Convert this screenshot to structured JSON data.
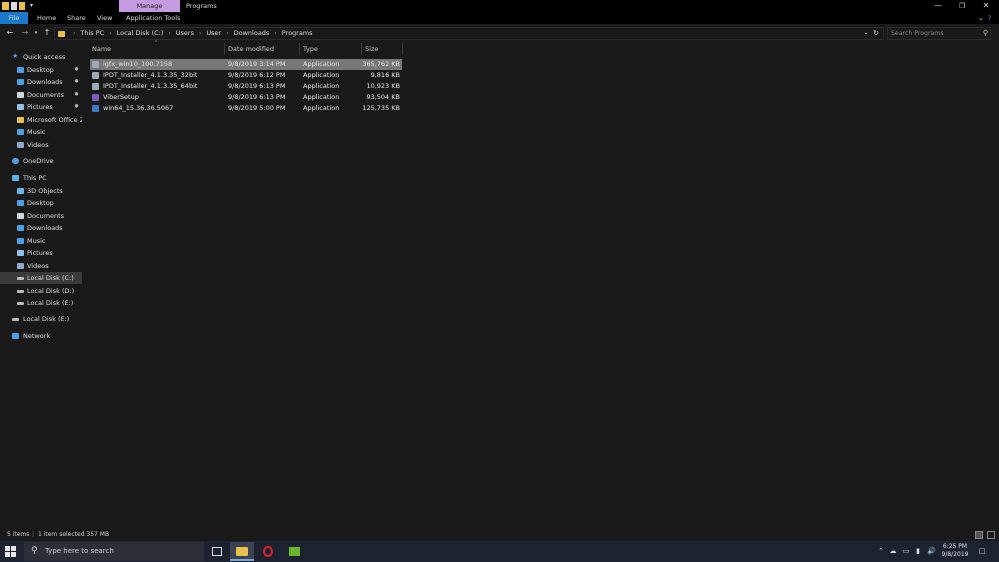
{
  "titlebar": {
    "contextual_tab": "Manage",
    "window_title": "Programs",
    "minimize": "—",
    "maximize": "❐",
    "close": "✕"
  },
  "ribbon": {
    "tabs": [
      "File",
      "Home",
      "Share",
      "View",
      "Application Tools"
    ]
  },
  "address": {
    "crumbs": [
      "This PC",
      "Local Disk (C:)",
      "Users",
      "User",
      "Downloads",
      "Programs"
    ],
    "search_placeholder": "Search Programs"
  },
  "nav": {
    "quick_access": "Quick access",
    "quick_items": [
      {
        "label": "Desktop",
        "icon": "desktop-icon",
        "pinned": true
      },
      {
        "label": "Downloads",
        "icon": "downloads-icon",
        "pinned": true
      },
      {
        "label": "Documents",
        "icon": "documents-icon",
        "pinned": true
      },
      {
        "label": "Pictures",
        "icon": "pictures-icon",
        "pinned": true
      },
      {
        "label": "Microsoft Office 20",
        "icon": "folder-icon",
        "pinned": false
      },
      {
        "label": "Music",
        "icon": "music-icon",
        "pinned": false
      },
      {
        "label": "Videos",
        "icon": "videos-icon",
        "pinned": false
      }
    ],
    "onedrive": "OneDrive",
    "this_pc": "This PC",
    "pc_items": [
      {
        "label": "3D Objects",
        "icon": "3d-objects-icon"
      },
      {
        "label": "Desktop",
        "icon": "desktop-icon"
      },
      {
        "label": "Documents",
        "icon": "documents-icon"
      },
      {
        "label": "Downloads",
        "icon": "downloads-icon"
      },
      {
        "label": "Music",
        "icon": "music-icon"
      },
      {
        "label": "Pictures",
        "icon": "pictures-icon"
      },
      {
        "label": "Videos",
        "icon": "videos-icon"
      },
      {
        "label": "Local Disk (C:)",
        "icon": "drive-icon",
        "selected": true
      },
      {
        "label": "Local Disk (D:)",
        "icon": "drive-icon"
      },
      {
        "label": "Local Disk (E:)",
        "icon": "drive-icon"
      }
    ],
    "drive_e": "Local Disk (E:)",
    "network": "Network"
  },
  "columns": {
    "name": "Name",
    "date": "Date modified",
    "type": "Type",
    "size": "Size"
  },
  "files": [
    {
      "name": "igfx_win10_100.7158",
      "date": "9/8/2019 3:14 PM",
      "type": "Application",
      "size": "365,762 KB",
      "selected": true
    },
    {
      "name": "IPDT_Installer_4.1.3.35_32bit",
      "date": "9/8/2019 6:12 PM",
      "type": "Application",
      "size": "9,816 KB"
    },
    {
      "name": "IPDT_Installer_4.1.3.35_64bit",
      "date": "9/8/2019 6:13 PM",
      "type": "Application",
      "size": "10,923 KB"
    },
    {
      "name": "ViberSetup",
      "date": "9/8/2019 6:13 PM",
      "type": "Application",
      "size": "93,504 KB"
    },
    {
      "name": "win64_15.36.36.5067",
      "date": "9/8/2019 5:00 PM",
      "type": "Application",
      "size": "125,735 KB"
    }
  ],
  "status": {
    "items": "5 items",
    "selected": "1 item selected  357 MB"
  },
  "taskbar": {
    "search_placeholder": "Type here to search",
    "time": "6:25 PM",
    "date": "9/8/2019"
  },
  "colors": {
    "accent": "#1979ca",
    "manage_tab": "#c49ae0",
    "folder": "#e8c04a",
    "selection": "#777777"
  }
}
